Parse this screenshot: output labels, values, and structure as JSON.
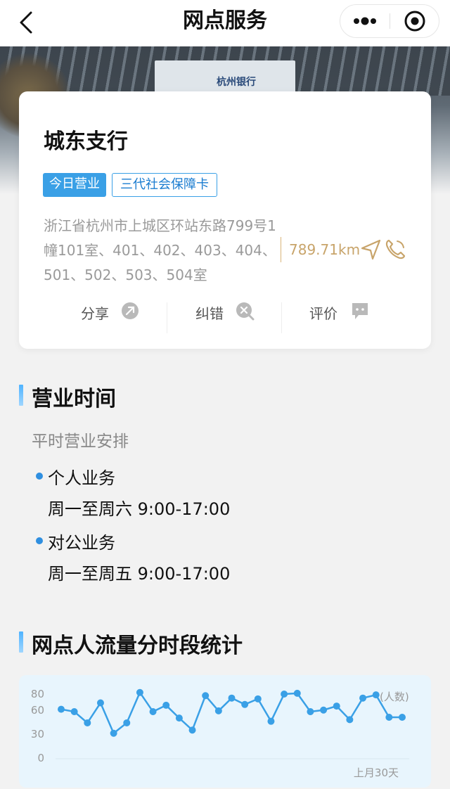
{
  "nav": {
    "title": "网点服务",
    "back_icon": "chevron-left-icon",
    "more_icon": "more-dots-icon",
    "target_icon": "target-icon"
  },
  "hero": {
    "sign_text": "杭州银行"
  },
  "branch": {
    "name": "城东支行",
    "tags": [
      "今日营业",
      "三代社会保障卡"
    ],
    "address": "浙江省杭州市上城区环站东路799号1幢101室、401、402、403、404、501、502、503、504室",
    "distance": "789.71km",
    "icons": [
      "navigation-arrow-icon",
      "phone-icon"
    ],
    "actions": [
      {
        "label": "分享",
        "icon": "share-icon"
      },
      {
        "label": "纠错",
        "icon": "correction-icon"
      },
      {
        "label": "评价",
        "icon": "comment-icon"
      }
    ]
  },
  "hours": {
    "title": "营业时间",
    "subtitle": "平时营业安排",
    "items": [
      {
        "name": "个人业务",
        "time": "周一至周六 9:00-17:00"
      },
      {
        "name": "对公业务",
        "time": "周一至周五 9:00-17:00"
      }
    ]
  },
  "traffic": {
    "title": "网点人流量分时段统计",
    "accent": "#3aa0e6"
  },
  "chart_data": {
    "type": "line",
    "unit_label": "(人数)",
    "x_end_label": "上月30天",
    "y_ticks": [
      0,
      30,
      60,
      80
    ],
    "ylim": [
      0,
      80
    ],
    "grid": false,
    "series": [
      {
        "values": [
          61,
          58,
          44,
          69,
          31,
          44,
          82,
          58,
          66,
          50,
          35,
          78,
          59,
          75,
          67,
          74,
          46,
          80,
          81,
          58,
          60,
          65,
          48,
          75,
          79,
          51,
          51
        ]
      }
    ]
  }
}
